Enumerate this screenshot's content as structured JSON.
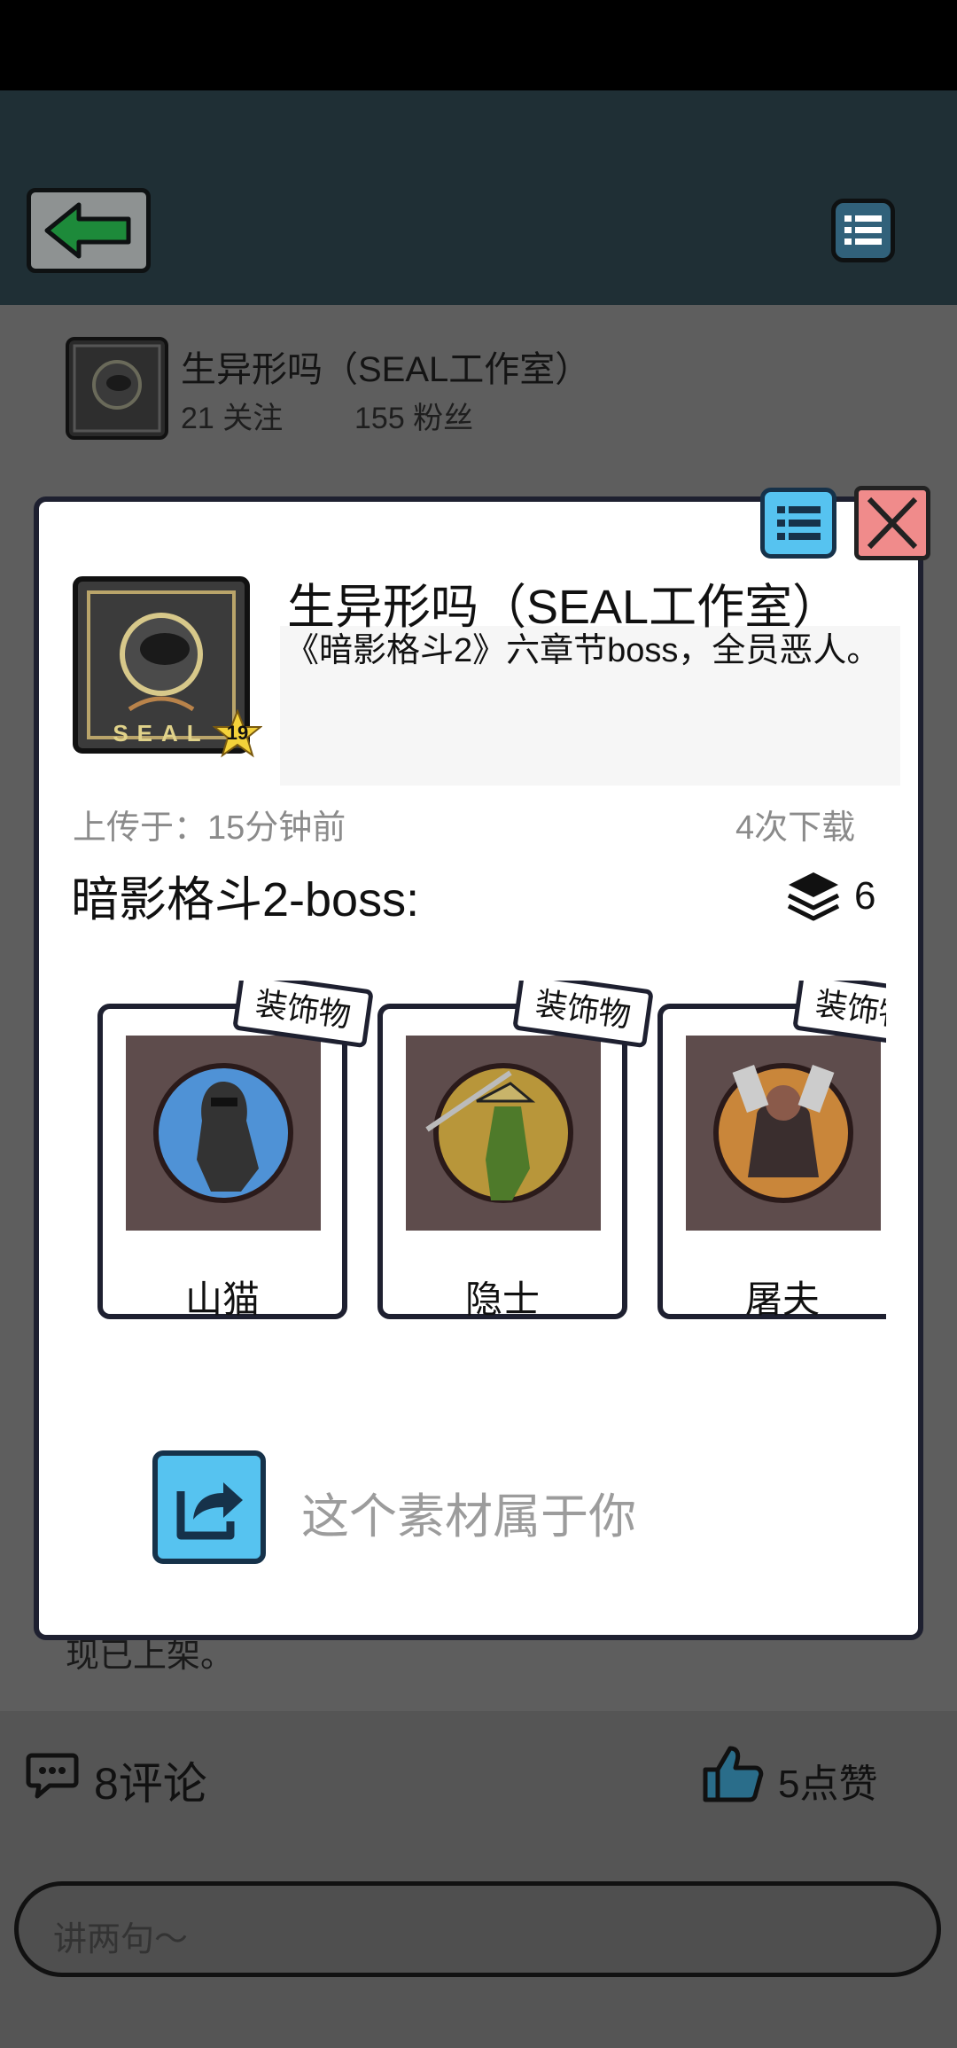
{
  "author": {
    "name": "生异形吗（SEAL工作室）",
    "following": "21 关注",
    "fans": "155 粉丝"
  },
  "background_text_tail": "现已上架。",
  "stats": {
    "comments": "8评论",
    "likes": "5点赞"
  },
  "comment_input": {
    "placeholder": "讲两句～"
  },
  "modal": {
    "title": "生异形吗（SEAL工作室）",
    "description": "《暗影格斗2》六章节boss，全员恶人。",
    "badge_level": "19",
    "thumb_label": "SEAL",
    "upload_time": "上传于：15分钟前",
    "downloads": "4次下载",
    "collection_name": "暗影格斗2-boss:",
    "item_count": "6",
    "items": [
      {
        "tag": "装饰物",
        "name": "山猫"
      },
      {
        "tag": "装饰物",
        "name": "隐士"
      },
      {
        "tag": "装饰物",
        "name": "屠夫"
      }
    ],
    "owner_text": "这个素材属于你"
  },
  "colors": {
    "header_bg": "#1f2f35",
    "accent_blue": "#56c3f0",
    "close_red": "#f08b8b",
    "overlay_gray": "#5e5e5e"
  },
  "icons": {
    "back": "arrow-left-icon",
    "menu": "list-icon",
    "close": "close-icon",
    "layers": "layers-icon",
    "share": "share-icon",
    "comment": "speech-bubble-icon",
    "like": "thumbs-up-icon"
  }
}
